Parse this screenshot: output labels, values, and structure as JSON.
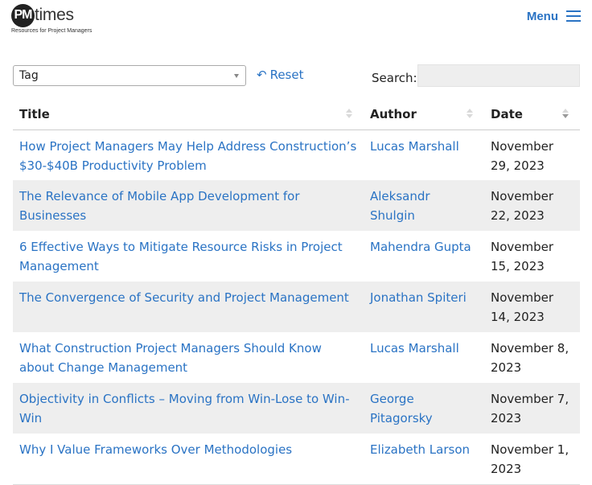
{
  "brand": {
    "logo_letters": "PM",
    "logo_word": "times",
    "tagline": "Resources for Project Managers"
  },
  "nav": {
    "menu_label": "Menu",
    "menu_icon": "hamburger-icon"
  },
  "filters": {
    "tag_selected": "Tag",
    "reset_label": "Reset",
    "search_label": "Search:",
    "search_value": ""
  },
  "table": {
    "columns": [
      "Title",
      "Author",
      "Date"
    ],
    "rows": [
      {
        "title": "How Project Managers May Help Address Construction’s $30-$40B Productivity Problem",
        "author": "Lucas Marshall",
        "date": "November 29, 2023"
      },
      {
        "title": "The Relevance of Mobile App Development for Businesses",
        "author": "Aleksandr Shulgin",
        "date": "November 22, 2023"
      },
      {
        "title": "6 Effective Ways to Mitigate Resource Risks in Project Management",
        "author": "Mahendra Gupta",
        "date": "November 15, 2023"
      },
      {
        "title": "The Convergence of Security and Project Management",
        "author": "Jonathan Spiteri",
        "date": "November 14, 2023"
      },
      {
        "title": "What Construction Project Managers Should Know about Change Management",
        "author": "Lucas Marshall",
        "date": "November 8, 2023"
      },
      {
        "title": "Objectivity in Conflicts – Moving from Win-Lose to Win-Win",
        "author": "George Pitagorsky",
        "date": "November 7, 2023"
      },
      {
        "title": "Why I Value Frameworks Over Methodologies",
        "author": "Elizabeth Larson",
        "date": "November 1, 2023"
      }
    ]
  },
  "colors": {
    "link": "#2a73c4",
    "stripe": "#eeeeee",
    "text": "#222222"
  }
}
